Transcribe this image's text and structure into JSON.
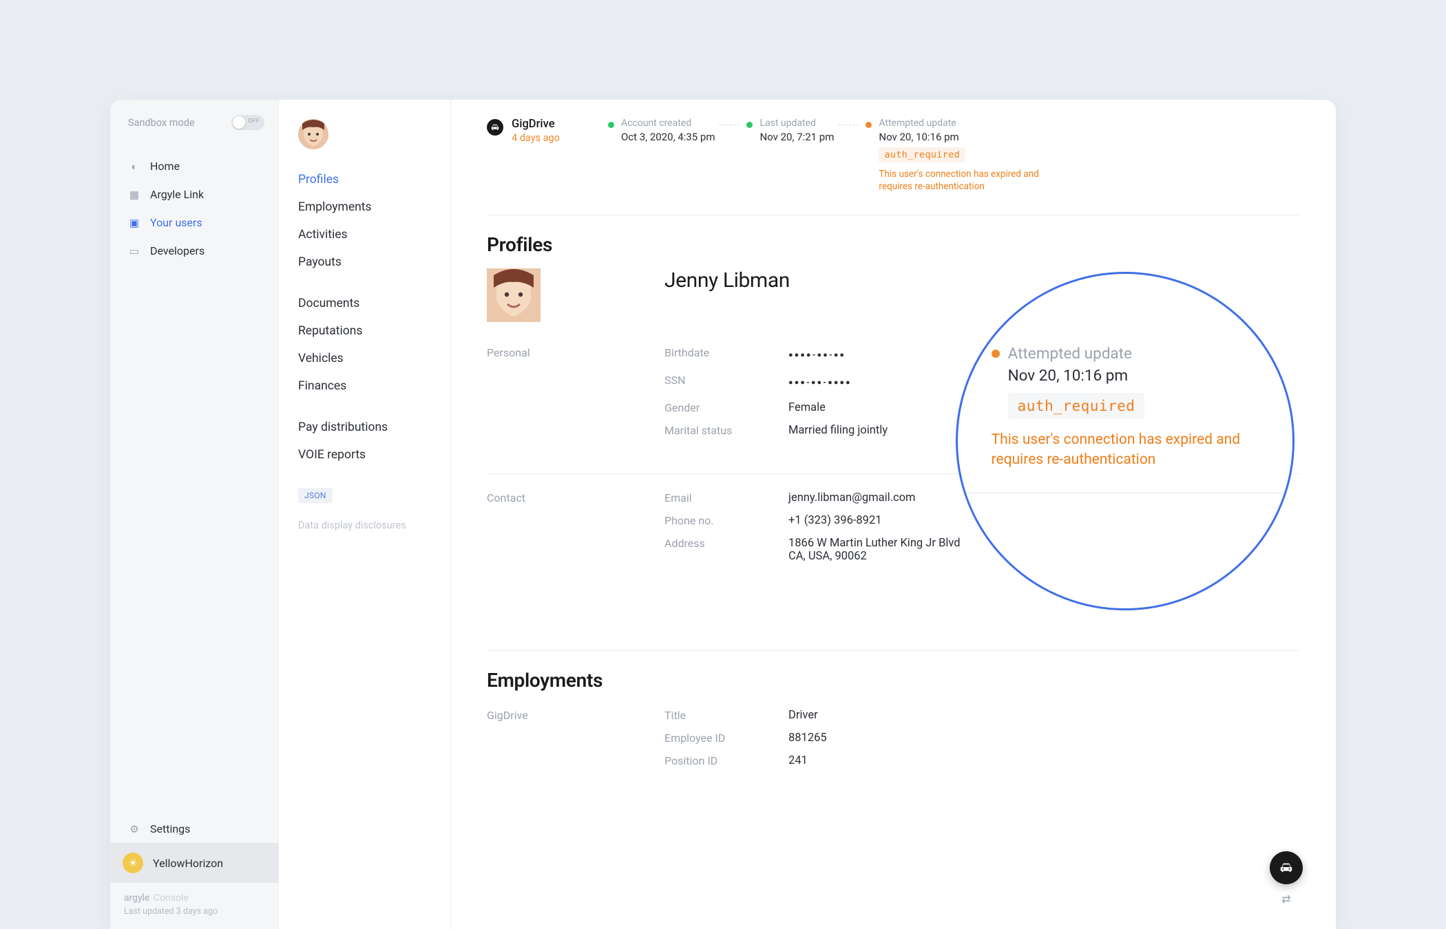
{
  "sandbox": {
    "label": "Sandbox mode",
    "toggle_text": "OFF"
  },
  "nav": {
    "items": [
      {
        "label": "Home"
      },
      {
        "label": "Argyle Link"
      },
      {
        "label": "Your users"
      },
      {
        "label": "Developers"
      }
    ],
    "settings_label": "Settings"
  },
  "workspace": {
    "name": "YellowHorizon"
  },
  "footer": {
    "brand_main": "argyle",
    "brand_sub": "Console",
    "updated": "Last updated 3 days ago"
  },
  "subnav": {
    "links": [
      "Profiles",
      "Employments",
      "Activities",
      "Payouts",
      "Documents",
      "Reputations",
      "Vehicles",
      "Finances",
      "Pay distributions",
      "VOIE reports"
    ],
    "json_chip": "JSON",
    "disclosure": "Data display disclosures"
  },
  "account": {
    "name": "GigDrive",
    "age": "4 days ago"
  },
  "timeline": {
    "created": {
      "label": "Account created",
      "value": "Oct 3, 2020, 4:35 pm"
    },
    "updated": {
      "label": "Last updated",
      "value": "Nov 20, 7:21 pm"
    },
    "attempt": {
      "label": "Attempted update",
      "value": "Nov 20, 10:16 pm",
      "code": "auth_required",
      "warning": "This user's connection has expired and requires re-authentication"
    }
  },
  "sections": {
    "profiles_title": "Profiles",
    "employments_title": "Employments"
  },
  "profile": {
    "full_name": "Jenny Libman",
    "personal_label": "Personal",
    "contact_label": "Contact",
    "personal": {
      "birthdate_k": "Birthdate",
      "birthdate_v": "●●●●-●●-●●",
      "ssn_k": "SSN",
      "ssn_v": "●●●-●●-●●●●",
      "gender_k": "Gender",
      "gender_v": "Female",
      "marital_k": "Marital status",
      "marital_v": "Married filing jointly"
    },
    "contact": {
      "email_k": "Email",
      "email_v": "jenny.libman@gmail.com",
      "phone_k": "Phone no.",
      "phone_v": "+1 (323) 396-8921",
      "address_k": "Address",
      "address_v1": "1866 W Martin Luther King Jr Blvd",
      "address_v2": "CA, USA, 90062"
    }
  },
  "employment": {
    "employer_label": "GigDrive",
    "title_k": "Title",
    "title_v": "Driver",
    "empid_k": "Employee ID",
    "empid_v": "881265",
    "posid_k": "Position ID",
    "posid_v": "241"
  },
  "magnifier": {
    "label": "Attempted update",
    "value": "Nov 20, 10:16 pm",
    "code": "auth_required",
    "warning": "This user's connection has expired and requires re-authentication"
  }
}
